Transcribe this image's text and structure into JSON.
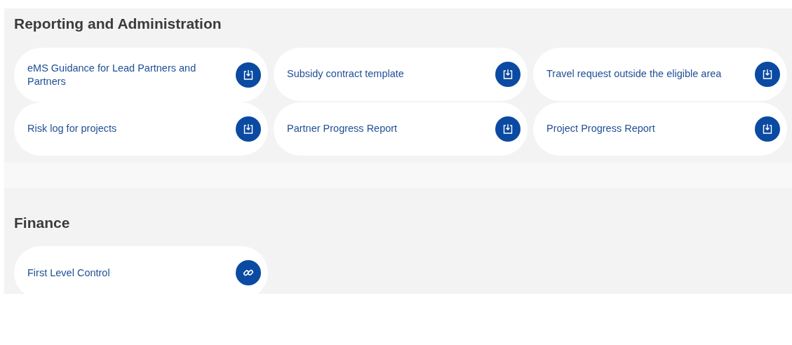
{
  "sections": [
    {
      "title": "Reporting and Administration",
      "items": [
        {
          "label": "eMS Guidance for Lead Partners and Partners",
          "kind": "download"
        },
        {
          "label": "Subsidy contract template",
          "kind": "download"
        },
        {
          "label": "Travel request outside the eligible area",
          "kind": "download"
        },
        {
          "label": "Risk log for projects",
          "kind": "download"
        },
        {
          "label": "Partner Progress Report",
          "kind": "download"
        },
        {
          "label": "Project Progress Report",
          "kind": "download"
        }
      ]
    },
    {
      "title": "Finance",
      "items": [
        {
          "label": "First Level Control",
          "kind": "link"
        }
      ]
    }
  ]
}
